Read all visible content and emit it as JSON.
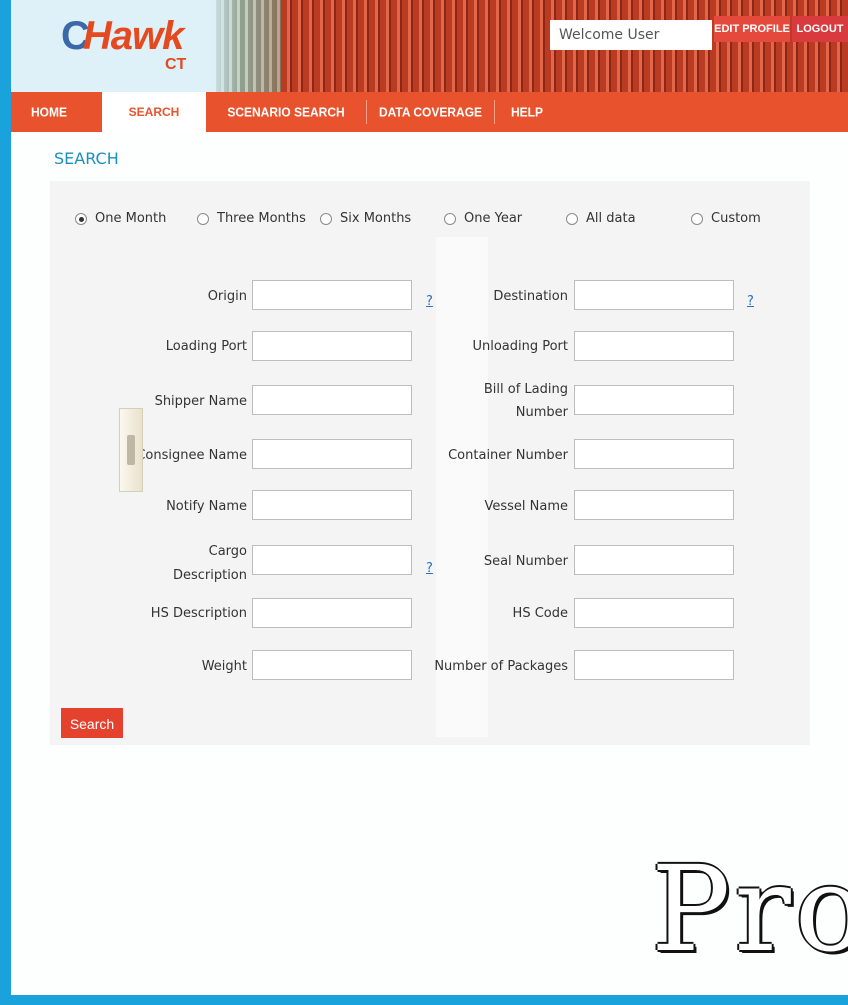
{
  "header": {
    "logo_main": "C",
    "logo_word": "Hawk",
    "logo_sub": "CT",
    "welcome": "Welcome User",
    "edit_profile": "EDIT PROFILE",
    "logout": "LOGOUT"
  },
  "nav": {
    "items": [
      {
        "label": "HOME"
      },
      {
        "label": "SEARCH",
        "active": true
      },
      {
        "label": "SCENARIO SEARCH"
      },
      {
        "label": "DATA COVERAGE"
      },
      {
        "label": "HELP"
      }
    ]
  },
  "page_title": "SEARCH",
  "time_range": {
    "options": [
      "One Month",
      "Three Months",
      "Six Months",
      "One Year",
      "All data",
      "Custom"
    ],
    "selected": "One Month"
  },
  "form": {
    "left": [
      {
        "label": "Origin",
        "value": "",
        "help": "?"
      },
      {
        "label": "Loading Port",
        "value": ""
      },
      {
        "label": "Shipper Name",
        "value": ""
      },
      {
        "label": "Consignee Name",
        "value": ""
      },
      {
        "label": "Notify Name",
        "value": ""
      },
      {
        "label_line1": "Cargo",
        "label_line2": "Description",
        "value": "",
        "help": "?"
      },
      {
        "label": "HS Description",
        "value": ""
      },
      {
        "label": "Weight",
        "value": ""
      }
    ],
    "right": [
      {
        "label": "Destination",
        "value": "",
        "help": "?"
      },
      {
        "label": "Unloading Port",
        "value": ""
      },
      {
        "label_line1": "Bill of Lading",
        "label_line2": "Number",
        "value": ""
      },
      {
        "label": "Container Number",
        "value": ""
      },
      {
        "label": "Vessel Name",
        "value": ""
      },
      {
        "label": "Seal Number",
        "value": ""
      },
      {
        "label": "HS Code",
        "value": ""
      },
      {
        "label": "Number of Packages",
        "value": ""
      }
    ]
  },
  "search_button": "Search",
  "watermark": "Pro",
  "colors": {
    "brand_orange": "#e8532d",
    "brand_blue": "#1aa2dc",
    "button_red": "#e4422f"
  }
}
